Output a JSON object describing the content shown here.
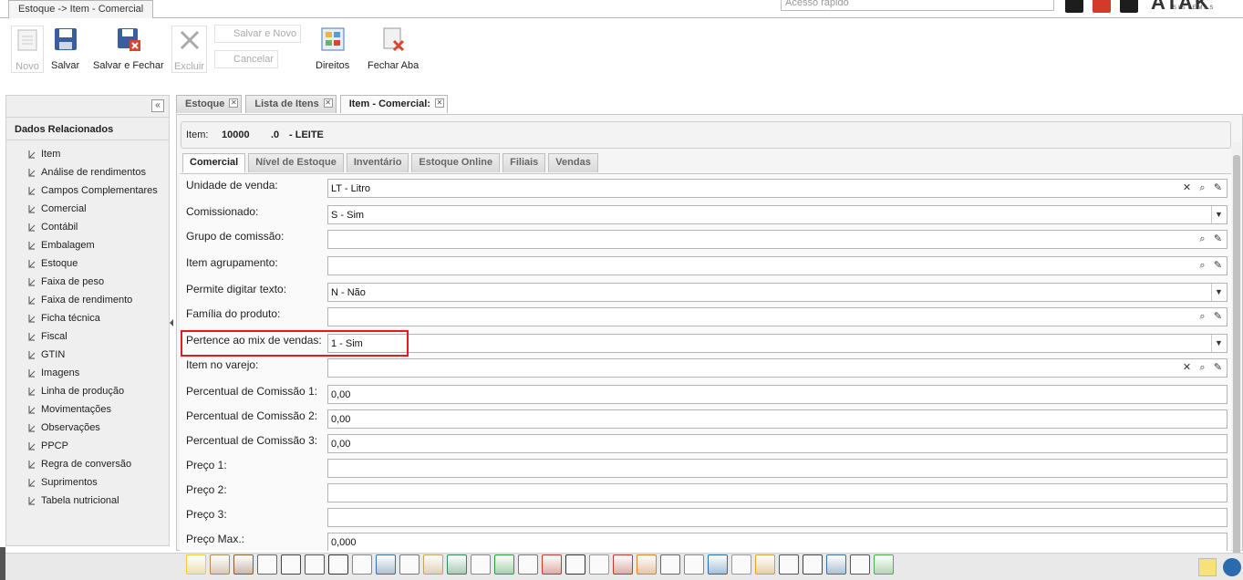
{
  "window": {
    "tab_title": "Estoque -> Item - Comercial",
    "quick_access_placeholder": "Acesso rápido"
  },
  "brand": {
    "name": "ATAK",
    "tagline": "SISTEMAS"
  },
  "toolbar": {
    "novo": "Novo",
    "salvar": "Salvar",
    "salvar_fechar": "Salvar e Fechar",
    "excluir": "Excluir",
    "salvar_novo": "Salvar e Novo",
    "cancelar": "Cancelar",
    "direitos": "Direitos",
    "fechar_aba": "Fechar Aba"
  },
  "left_panel": {
    "collapse": "«",
    "title": "Dados Relacionados",
    "items": [
      "Item",
      "Análise de rendimentos",
      "Campos Complementares",
      "Comercial",
      "Contábil",
      "Embalagem",
      "Estoque",
      "Faixa de peso",
      "Faixa de rendimento",
      "Ficha técnica",
      "Fiscal",
      "GTIN",
      "Imagens",
      "Linha de produção",
      "Movimentações",
      "Observações",
      "PPCP",
      "Regra de conversão",
      "Suprimentos",
      "Tabela nutricional"
    ]
  },
  "doc_tabs": [
    "Estoque",
    "Lista de Itens",
    "Item - Comercial:"
  ],
  "item_header": {
    "label": "Item:",
    "code": "10000",
    "suffix": ".0",
    "name": "- LEITE"
  },
  "sub_tabs": [
    "Comercial",
    "Nível de Estoque",
    "Inventário",
    "Estoque Online",
    "Filiais",
    "Vendas"
  ],
  "fields": [
    {
      "label": "Unidade de venda:",
      "value": "LT - Litro"
    },
    {
      "label": "Comissionado:",
      "value": "S - Sim"
    },
    {
      "label": "Grupo de comissão:",
      "value": ""
    },
    {
      "label": "Item agrupamento:",
      "value": ""
    },
    {
      "label": "Permite digitar texto:",
      "value": "N - Não"
    },
    {
      "label": "Família do produto:",
      "value": ""
    },
    {
      "label": "Pertence ao mix de vendas:",
      "value": "1 - Sim"
    },
    {
      "label": "Item no varejo:",
      "value": ""
    },
    {
      "label": "Percentual de Comissão 1:",
      "value": "0,00"
    },
    {
      "label": "Percentual de Comissão 2:",
      "value": "0,00"
    },
    {
      "label": "Percentual de Comissão 3:",
      "value": "0,00"
    },
    {
      "label": "Preço 1:",
      "value": ""
    },
    {
      "label": "Preço 2:",
      "value": ""
    },
    {
      "label": "Preço 3:",
      "value": ""
    },
    {
      "label": "Preço Max.:",
      "value": "0,000"
    }
  ],
  "icons": {
    "clear": "✕",
    "search": "⌕",
    "edit": "✎",
    "dropdown": "▼"
  },
  "colors": {
    "highlight": "#e21b1b",
    "accent_blue": "#2a6bb0"
  }
}
